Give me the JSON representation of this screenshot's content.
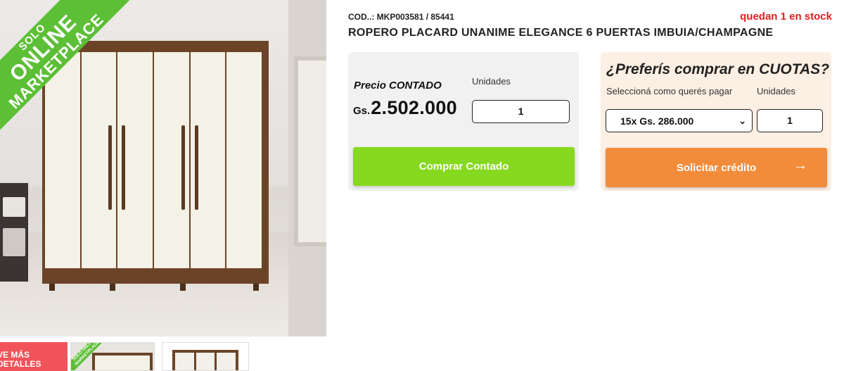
{
  "photo": {
    "badge": {
      "line1": "SOLO",
      "line2": "ONLINE",
      "line3": "MARKETPLACE"
    },
    "thumbnails": {
      "promo_line1": "VE MÁS",
      "promo_line2": "DETALLES",
      "mini_badge": "SOLO ONLINE MARKETPLACE"
    }
  },
  "product": {
    "code": "COD..: MKP003581 / 85441",
    "stock": "quedan 1 en stock",
    "title": "ROPERO PLACARD UNANIME ELEGANCE 6 PUERTAS IMBUIA/CHAMPAGNE"
  },
  "cash": {
    "price_label": "Precio CONTADO",
    "units_label": "Unidades",
    "currency": "Gs.",
    "price": "2.502.000",
    "quantity": "1",
    "buy_button": "Comprar Contado",
    "button_color": "#86d91e"
  },
  "credit": {
    "heading": "¿Preferís comprar en CUOTAS?",
    "select_label": "Seleccioná como querés pagar",
    "units_label": "Unidades",
    "installment_selected": "15x Gs. 286.000",
    "quantity": "1",
    "request_button": "Solicitar crédito",
    "arrow_icon": "→",
    "button_color": "#f28c3b"
  },
  "colors": {
    "stock_red": "#e02020",
    "badge_green": "#5cbf36",
    "wood": "#6b4428"
  }
}
